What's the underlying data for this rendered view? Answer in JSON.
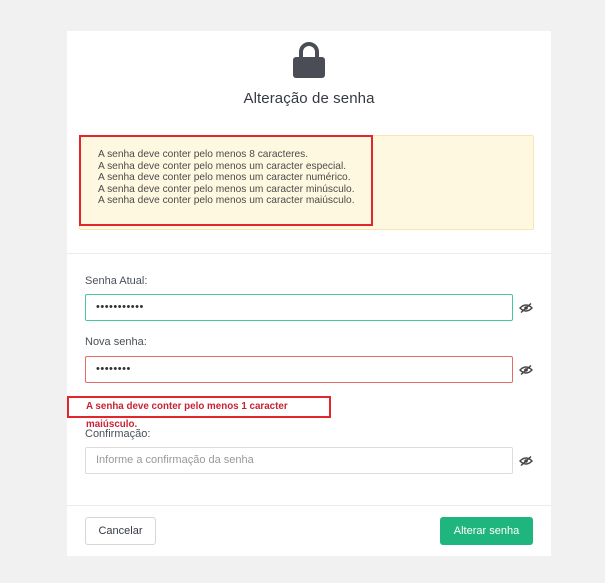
{
  "header": {
    "icon": "lock-icon",
    "title": "Alteração de senha"
  },
  "requirements": [
    "A senha deve conter pelo menos 8 caracteres.",
    "A senha deve conter pelo menos um caracter especial.",
    "A senha deve conter pelo menos um caracter numérico.",
    "A senha deve conter pelo menos um caracter minúsculo.",
    "A senha deve conter pelo menos um caracter maiúsculo."
  ],
  "fields": {
    "current": {
      "label": "Senha Atual:",
      "value": "•••••••••••",
      "state": "valid"
    },
    "new": {
      "label": "Nova senha:",
      "value": "••••••••",
      "state": "invalid"
    },
    "confirm": {
      "label": "Confirmação:",
      "value": "",
      "placeholder": "Informe a confirmação da senha"
    }
  },
  "error_message": "A senha deve conter pelo menos 1 caracter maiúsculo.",
  "buttons": {
    "cancel": "Cancelar",
    "submit": "Alterar senha"
  },
  "colors": {
    "accent": "#1fb57e",
    "valid_border": "#46c89b",
    "invalid_border": "#e46a6a",
    "error_text": "#c82333",
    "alert_bg": "#fff8e1",
    "highlight": "#e3262b"
  }
}
